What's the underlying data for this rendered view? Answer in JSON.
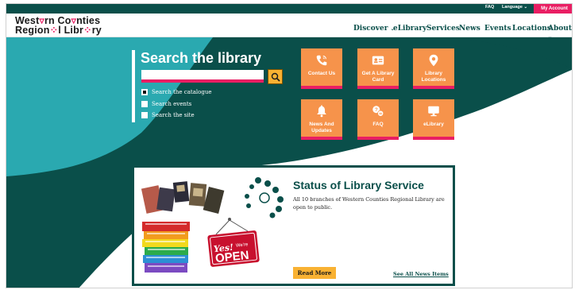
{
  "utility": {
    "faq": "FAQ",
    "language": "Language",
    "my_account": "My Account"
  },
  "logo": {
    "line1_a": "West",
    "line1_mark": "ᵾ",
    "line1_b": "rn Co",
    "line1_mark2": "ᵾ",
    "line1_c": "nties",
    "line2_a": "Region",
    "line2_mark": "□",
    "line2_b": "l Libr",
    "line2_mark2": "▫",
    "line2_c": "ry"
  },
  "nav": {
    "discover": "Discover",
    "elibrary": "eLibrary",
    "services": "Services",
    "news": "News",
    "events": "Events",
    "locations": "Locations",
    "about": "About"
  },
  "search": {
    "title": "Search the library",
    "input_value": "",
    "options": [
      "Search the catalogue",
      "Search events",
      "Search the site"
    ],
    "selected": "Search the catalogue"
  },
  "tiles": [
    {
      "label": "Contact Us",
      "icon": "phone-icon"
    },
    {
      "label": "Get A Library Card",
      "icon": "card-icon"
    },
    {
      "label": "Library Locations",
      "icon": "location-pin-icon"
    },
    {
      "label": "News And Updates",
      "icon": "bell-icon"
    },
    {
      "label": "FAQ",
      "icon": "faq-chat-icon"
    },
    {
      "label": "eLibrary",
      "icon": "monitor-icon"
    }
  ],
  "status": {
    "title": "Status of Library Service",
    "text": "All 10 branches of Western Counties Regional Library are open to public.",
    "read_more": "Read More",
    "see_all": "See All News Items",
    "sign_yes": "Yes!",
    "sign_were": "We're",
    "sign_open": "OPEN"
  },
  "colors": {
    "teal_dark": "#0a4f4a",
    "teal_light": "#2aa9b0",
    "pink": "#e91e63",
    "orange": "#f6934b",
    "yellow": "#f9b233"
  }
}
